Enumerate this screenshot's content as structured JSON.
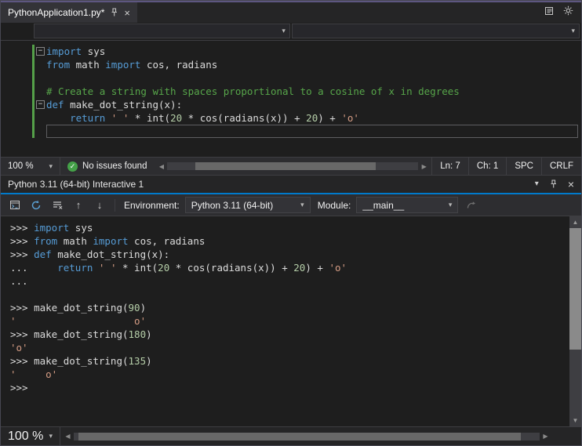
{
  "icons": {
    "chevron_down": "▾",
    "close": "×",
    "check": "✓",
    "minus": "−",
    "arrow_up": "↑",
    "arrow_down": "↓",
    "triangle_left": "◀",
    "triangle_right": "▶",
    "triangle_up": "▲",
    "triangle_down": "▼"
  },
  "colors": {
    "keyword": "#569cd6",
    "string": "#d69d85",
    "comment": "#57a64a",
    "number": "#b5cea8",
    "text": "#dcdcdc",
    "accent_blue": "#007acc",
    "change_bar_green": "#55a049"
  },
  "editor": {
    "tab_title": "PythonApplication1.py*",
    "code_lines": [
      {
        "fold": true,
        "modified": true,
        "tokens": [
          [
            "kw",
            "import"
          ],
          [
            "pl",
            " sys"
          ]
        ]
      },
      {
        "modified": true,
        "tokens": [
          [
            "kw",
            "from"
          ],
          [
            "pl",
            " math "
          ],
          [
            "kw",
            "import"
          ],
          [
            "pl",
            " cos, radians"
          ]
        ]
      },
      {
        "modified": true,
        "tokens": []
      },
      {
        "modified": true,
        "tokens": [
          [
            "cm",
            "# Create a string with spaces proportional to a cosine of x in degrees"
          ]
        ]
      },
      {
        "fold": true,
        "modified": true,
        "tokens": [
          [
            "kw",
            "def"
          ],
          [
            "pl",
            " make_dot_string(x):"
          ]
        ]
      },
      {
        "modified": true,
        "tokens": [
          [
            "pl",
            "    "
          ],
          [
            "kw",
            "return"
          ],
          [
            "pl",
            " "
          ],
          [
            "str",
            "' '"
          ],
          [
            "pl",
            " * int("
          ],
          [
            "num",
            "20"
          ],
          [
            "pl",
            " * cos(radians(x)) + "
          ],
          [
            "num",
            "20"
          ],
          [
            "pl",
            ") + "
          ],
          [
            "str",
            "'o'"
          ]
        ]
      },
      {
        "modified": true,
        "current": true,
        "tokens": []
      }
    ],
    "status": {
      "zoom": "100 %",
      "issues": "No issues found",
      "line": "Ln: 7",
      "column": "Ch: 1",
      "spaces": "SPC",
      "line_ending": "CRLF"
    }
  },
  "interactive": {
    "title": "Python 3.11 (64-bit) Interactive 1",
    "toolbar": {
      "environment_label": "Environment:",
      "environment_value": "Python 3.11 (64-bit)",
      "module_label": "Module:",
      "module_value": "__main__"
    },
    "console_lines": [
      {
        "tokens": [
          [
            "pl",
            ">>> "
          ],
          [
            "kw",
            "import"
          ],
          [
            "pl",
            " sys"
          ]
        ]
      },
      {
        "tokens": [
          [
            "pl",
            ">>> "
          ],
          [
            "kw",
            "from"
          ],
          [
            "pl",
            " math "
          ],
          [
            "kw",
            "import"
          ],
          [
            "pl",
            " cos, radians"
          ]
        ]
      },
      {
        "tokens": [
          [
            "pl",
            ">>> "
          ],
          [
            "kw",
            "def"
          ],
          [
            "pl",
            " make_dot_string(x):"
          ]
        ]
      },
      {
        "tokens": [
          [
            "pl",
            "...     "
          ],
          [
            "kw",
            "return"
          ],
          [
            "pl",
            " "
          ],
          [
            "str",
            "' '"
          ],
          [
            "pl",
            " * int("
          ],
          [
            "num",
            "20"
          ],
          [
            "pl",
            " * cos(radians(x)) + "
          ],
          [
            "num",
            "20"
          ],
          [
            "pl",
            ") + "
          ],
          [
            "str",
            "'o'"
          ]
        ]
      },
      {
        "tokens": [
          [
            "pl",
            "..."
          ]
        ]
      },
      {
        "tokens": []
      },
      {
        "tokens": [
          [
            "pl",
            ">>> make_dot_string("
          ],
          [
            "num",
            "90"
          ],
          [
            "pl",
            ")"
          ]
        ]
      },
      {
        "tokens": [
          [
            "str",
            "'                    o'"
          ]
        ]
      },
      {
        "tokens": [
          [
            "pl",
            ">>> make_dot_string("
          ],
          [
            "num",
            "180"
          ],
          [
            "pl",
            ")"
          ]
        ]
      },
      {
        "tokens": [
          [
            "str",
            "'o'"
          ]
        ]
      },
      {
        "tokens": [
          [
            "pl",
            ">>> make_dot_string("
          ],
          [
            "num",
            "135"
          ],
          [
            "pl",
            ")"
          ]
        ]
      },
      {
        "tokens": [
          [
            "str",
            "'     o'"
          ]
        ]
      },
      {
        "tokens": [
          [
            "pl",
            ">>>"
          ]
        ]
      }
    ],
    "status": {
      "zoom": "100 %"
    }
  }
}
